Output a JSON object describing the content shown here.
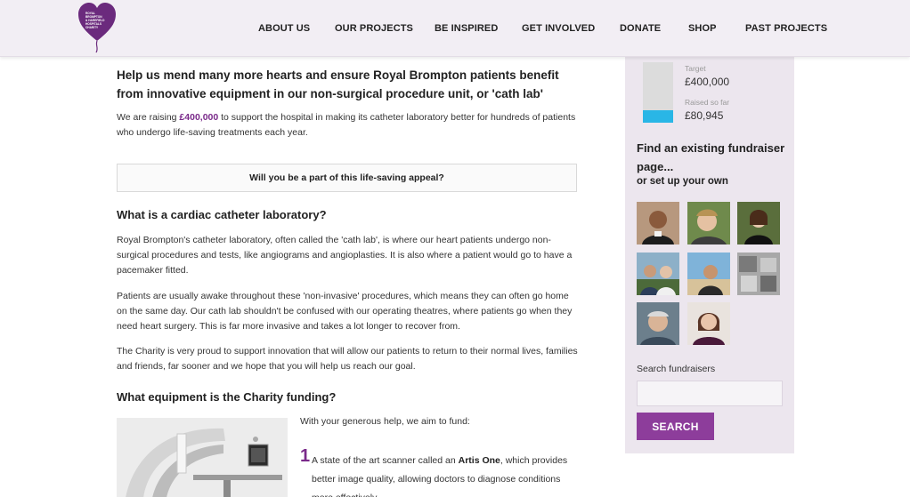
{
  "brand": {
    "logo_lines": [
      "ROYAL",
      "BROMPTON",
      "& HAREFIELD",
      "HOSPITALS",
      "CHARITY"
    ],
    "logo_color": "#6b2a7d"
  },
  "nav": {
    "items": [
      {
        "label": "ABOUT US"
      },
      {
        "label": "OUR PROJECTS"
      },
      {
        "label": "BE INSPIRED"
      },
      {
        "label": "GET INVOLVED"
      },
      {
        "label": "DONATE"
      },
      {
        "label": "SHOP"
      },
      {
        "label": "PAST PROJECTS"
      }
    ]
  },
  "main": {
    "intro_heading": "Help us mend many more hearts and ensure Royal Brompton patients benefit from innovative equipment in our non-surgical procedure unit, or 'cath lab'",
    "raising": {
      "before": "We are raising ",
      "amount": "£400,000",
      "after": " to support the hospital in making its catheter laboratory better for hundreds of patients who undergo life-saving treatments each year."
    },
    "callout": "Will you be a part of this life-saving appeal?",
    "section1_heading": "What is a cardiac catheter laboratory?",
    "section1_p1": "Royal Brompton's catheter laboratory, often called the 'cath lab', is where our heart patients undergo non-surgical procedures and tests, like angiograms and angioplasties. It is also where a patient would go to have a pacemaker fitted.",
    "section1_p2": "Patients are usually awake throughout these 'non-invasive' procedures, which means they can often go home on the same day. Our cath lab shouldn't be confused with our operating theatres, where patients go when they need heart surgery. This is far more invasive and takes a lot longer to recover from.",
    "section1_p3": "The Charity is very proud to support innovation that will allow our patients to return to their normal lives, families and friends, far sooner and we hope that you will help us reach our goal.",
    "section2_heading": "What equipment is the Charity funding?",
    "fund_intro": "With your generous help, we aim to fund:",
    "items": [
      {
        "number": "1",
        "before": "A state of the art scanner called an ",
        "bold": "Artis One",
        "after": ", which provides better image quality, allowing doctors to diagnose conditions more effectively."
      }
    ]
  },
  "sidebar": {
    "target_label": "Target",
    "target_value": "£400,000",
    "raised_label": "Raised so far",
    "raised_value": "£80,945",
    "progress_fraction": 0.2,
    "progress_color": "#29b6e6",
    "find_title": "Find an existing fundraiser page...",
    "find_sub": "or set up your own",
    "search_label": "Search fundraisers",
    "search_placeholder": "",
    "search_button": "SEARCH",
    "button_color": "#8d3d9b"
  }
}
